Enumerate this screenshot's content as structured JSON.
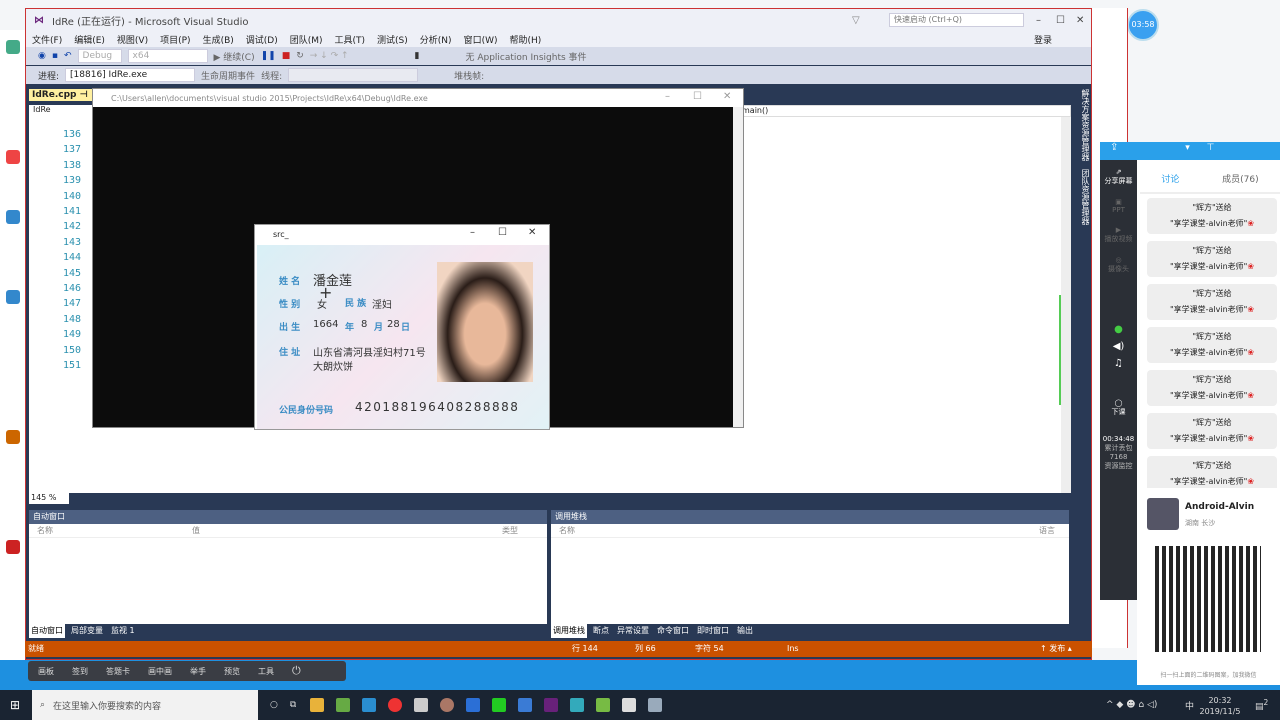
{
  "vs": {
    "title": "IdRe (正在运行) - Microsoft Visual Studio",
    "quick_launch": "快速启动 (Ctrl+Q)",
    "signin": "登录",
    "menu": [
      "文件(F)",
      "编辑(E)",
      "视图(V)",
      "项目(P)",
      "生成(B)",
      "调试(D)",
      "团队(M)",
      "工具(T)",
      "测试(S)",
      "分析(N)",
      "窗口(W)",
      "帮助(H)"
    ],
    "toolbar": {
      "config": "Debug",
      "platform": "x64",
      "continue": "▶ 继续(C)",
      "insights": "无 Application Insights 事件"
    },
    "toolbar2": {
      "process_label": "进程:",
      "process": "[18816] IdRe.exe",
      "lifecycle": "生命周期事件",
      "thread": "线程:",
      "stackframe": "堆栈帧:"
    },
    "tab": "IdRe.cpp",
    "scope": "IdRe",
    "function": "main()",
    "zoom": "145 %",
    "line_numbers": [
      "136",
      "137",
      "138",
      "139",
      "140",
      "141",
      "142",
      "143",
      "144",
      "145",
      "146",
      "147",
      "148",
      "149",
      "150",
      "151"
    ],
    "side_tabs": [
      "解决方案资源管理器",
      "团队资源管理器"
    ],
    "autos": {
      "title": "自动窗口",
      "cols": [
        "名称",
        "值",
        "类型"
      ],
      "tabs": [
        "自动窗口",
        "局部变量",
        "监视 1"
      ]
    },
    "callstack": {
      "title": "调用堆栈",
      "cols": [
        "名称",
        "语言"
      ],
      "tabs": [
        "调用堆栈",
        "断点",
        "异常设置",
        "命令窗口",
        "即时窗口",
        "输出"
      ]
    },
    "status": {
      "ready": "就绪",
      "line": "行 144",
      "col": "列 66",
      "char": "字符 54",
      "ins": "Ins",
      "publish": "↑ 发布 ▴"
    }
  },
  "console": {
    "title": "C:\\Users\\allen\\documents\\visual studio 2015\\Projects\\IdRe\\x64\\Debug\\IdRe.exe"
  },
  "src": {
    "title": "src_",
    "name_label": "姓 名",
    "name": "潘金莲",
    "sex_label": "性 别",
    "sex": "女",
    "nation_label": "民 族",
    "nation": "淫妇",
    "birth_label": "出 生",
    "birth_year": "1664",
    "year": "年",
    "birth_month": "8",
    "month": "月",
    "birth_day": "28",
    "day": "日",
    "addr_label": "住 址",
    "addr1": "山东省清河县淫妇村71号",
    "addr2": "大朗炊饼",
    "id_label": "公民身份号码",
    "id": "420188196408288888"
  },
  "chat": {
    "tabs": [
      "讨论",
      "成员(76)"
    ],
    "side": [
      "分享屏幕",
      "PPT",
      "播放视频",
      "摄像头",
      "下课"
    ],
    "time": "00:34:48",
    "lost_label": "累计丢包",
    "lost": "7168",
    "res": "资源监控",
    "msg_line1": "\"辉方\"送给",
    "msg_line2": "\"享学课堂-alvin老师\"",
    "msg_count": 7
  },
  "profile": {
    "name": "Android-Alvin",
    "location": "湖南 长沙",
    "caption": "扫一扫上面的二维码图案，加我微信"
  },
  "timer": "03:58",
  "bottombar": [
    "画板",
    "签到",
    "答题卡",
    "画中画",
    "举手",
    "预览",
    "工具"
  ],
  "taskbar": {
    "search": "在这里输入你要搜索的内容",
    "time": "20:32",
    "date": "2019/11/5",
    "ime": "中",
    "notif": "2"
  }
}
